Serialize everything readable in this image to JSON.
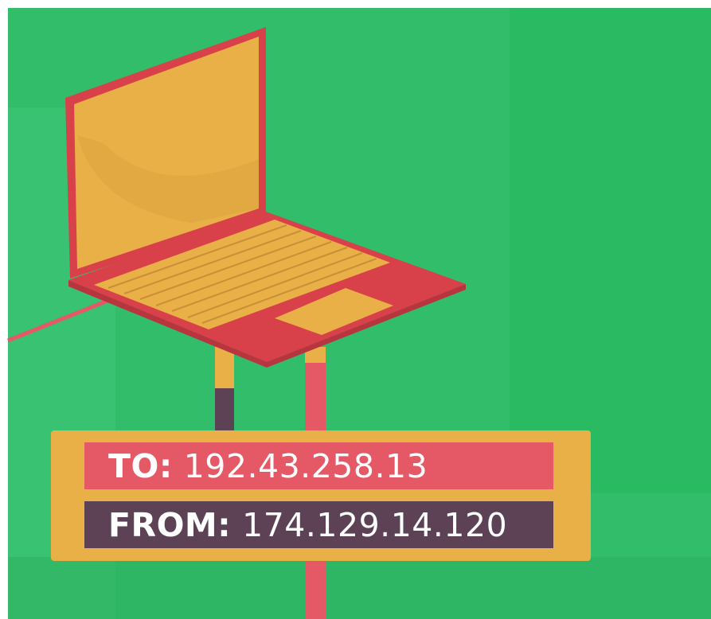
{
  "packet": {
    "to_label": "TO:",
    "to_address": "192.43.258.13",
    "from_label": "FROM:",
    "from_address": "174.129.14.120"
  },
  "colors": {
    "background_green": "#2fbf66",
    "laptop_yellow": "#eab048",
    "laptop_red": "#d9414a",
    "cable_pink": "#e55865",
    "cable_purple": "#5d4256",
    "address_to_bg": "#e55865",
    "address_from_bg": "#5d4256"
  },
  "icons": [
    "laptop-icon",
    "network-cable"
  ]
}
